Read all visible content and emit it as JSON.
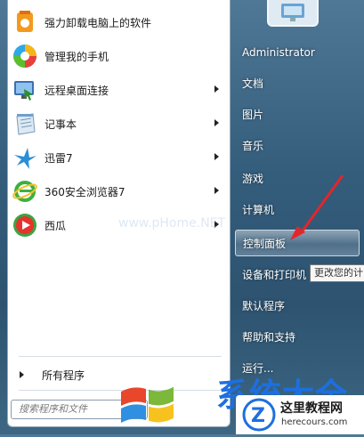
{
  "programs": [
    {
      "label": "强力卸载电脑上的软件",
      "icon": "uninstaller-icon",
      "has_arrow": false
    },
    {
      "label": "管理我的手机",
      "icon": "phone-manager-icon",
      "has_arrow": false
    },
    {
      "label": "远程桌面连接",
      "icon": "remote-desktop-icon",
      "has_arrow": true
    },
    {
      "label": "记事本",
      "icon": "notepad-icon",
      "has_arrow": true
    },
    {
      "label": "迅雷7",
      "icon": "thunder-bird-icon",
      "has_arrow": true
    },
    {
      "label": "360安全浏览器7",
      "icon": "360-browser-icon",
      "has_arrow": true
    },
    {
      "label": "西瓜",
      "icon": "xigua-player-icon",
      "has_arrow": true
    }
  ],
  "all_programs_label": "所有程序",
  "search_placeholder": "搜索程序和文件",
  "right_menu": {
    "username": "Administrator",
    "items": [
      "文档",
      "图片",
      "音乐",
      "游戏",
      "计算机",
      "控制面板",
      "设备和打印机",
      "默认程序",
      "帮助和支持",
      "运行..."
    ],
    "highlighted": "控制面板"
  },
  "tooltip_text": "更改您的计",
  "watermark_text": "www.pHome.NET",
  "banner": {
    "logo_text": "系统大全",
    "site_title": "这里教程网",
    "site_url": "herecours.com"
  },
  "colors": {
    "highlight_border": "#c8d8e6",
    "arrow_annotation": "#e3262a",
    "logo_blue": "#1d6fe0"
  }
}
